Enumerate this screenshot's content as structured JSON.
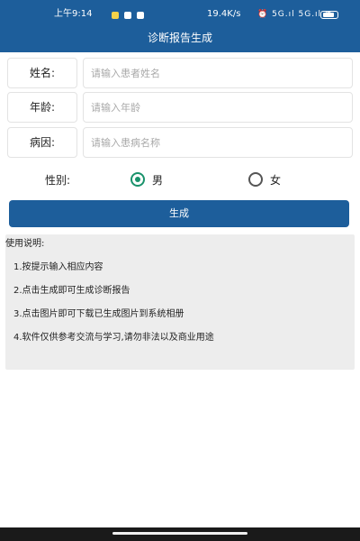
{
  "status_bar": {
    "time": "上午9:14",
    "net_speed": "19.4K/s",
    "signal_icons": "⏰ 5G.ıl 5G.ıl ≋",
    "battery_icon": "battery-icon"
  },
  "header": {
    "title": "诊断报告生成"
  },
  "form": {
    "name": {
      "label": "姓名:",
      "placeholder": "请输入患者姓名"
    },
    "age": {
      "label": "年龄:",
      "placeholder": "请输入年龄"
    },
    "cause": {
      "label": "病因:",
      "placeholder": "请输入患病名称"
    }
  },
  "gender": {
    "label": "性别:",
    "options": [
      {
        "label": "男",
        "selected": true
      },
      {
        "label": "女",
        "selected": false
      }
    ]
  },
  "generate_button": "生成",
  "instructions": {
    "title": "使用说明:",
    "items": [
      "1.按提示输入相应内容",
      "2.点击生成即可生成诊断报告",
      "3.点击图片即可下载已生成图片到系统相册",
      "4.软件仅供参考交流与学习,请勿非法以及商业用途"
    ]
  },
  "colors": {
    "primary": "#1d5e9b",
    "radio_selected": "#19926b",
    "notes_background": "#ededed"
  }
}
